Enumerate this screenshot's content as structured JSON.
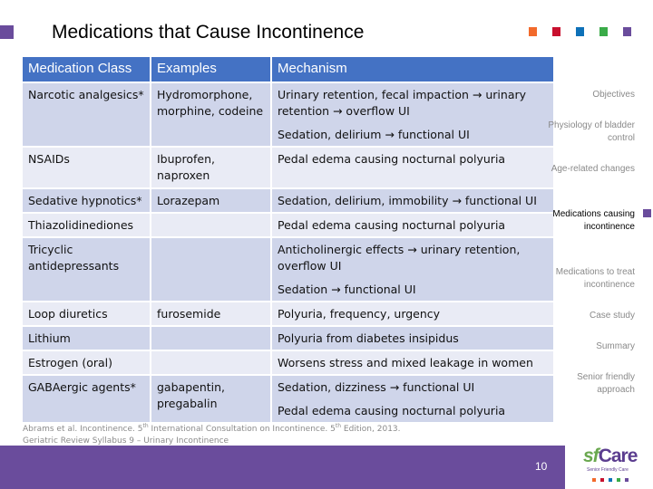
{
  "slide": {
    "title": "Medications that Cause Incontinence",
    "page_number": "10",
    "accent_color": "#6a4c9c",
    "top_squares": [
      "#f26a2b",
      "#c8102e",
      "#0e71b8",
      "#3aab48",
      "#6a4c9c"
    ]
  },
  "table": {
    "headers": [
      "Medication Class",
      "Examples",
      "Mechanism"
    ],
    "rows": [
      {
        "class": "Narcotic analgesics*",
        "examples": "Hydromorphone, morphine, codeine",
        "mechanism": [
          "Urinary retention, fecal impaction → urinary retention → overflow UI",
          "Sedation, delirium → functional UI"
        ]
      },
      {
        "class": "NSAIDs",
        "examples": "Ibuprofen, naproxen",
        "mechanism": [
          "Pedal edema causing nocturnal polyuria"
        ]
      },
      {
        "class": "Sedative hypnotics*",
        "examples": "Lorazepam",
        "mechanism": [
          "Sedation, delirium, immobility → functional UI"
        ]
      },
      {
        "class": "Thiazolidinediones",
        "examples": "",
        "mechanism": [
          "Pedal edema causing nocturnal polyuria"
        ]
      },
      {
        "class": "Tricyclic antidepressants",
        "examples": "",
        "mechanism": [
          "Anticholinergic effects → urinary retention, overflow UI",
          "Sedation →  functional UI"
        ]
      },
      {
        "class": "Loop diuretics",
        "examples": "furosemide",
        "mechanism": [
          "Polyuria, frequency, urgency"
        ]
      },
      {
        "class": "Lithium",
        "examples": "",
        "mechanism": [
          "Polyuria from diabetes insipidus"
        ]
      },
      {
        "class": "Estrogen (oral)",
        "examples": "",
        "mechanism": [
          "Worsens stress and mixed leakage in women"
        ]
      },
      {
        "class": "GABAergic agents*",
        "examples": "gabapentin, pregabalin",
        "mechanism": [
          "Sedation, dizziness → functional UI",
          "Pedal edema causing nocturnal polyuria"
        ]
      }
    ]
  },
  "sidebar": {
    "items": [
      {
        "label": "Objectives",
        "active": false
      },
      {
        "label": "Physiology of bladder control",
        "active": false
      },
      {
        "label": "Age-related changes",
        "active": false
      },
      {
        "label": "Medications causing incontinence",
        "active": true
      },
      {
        "label": "Medications to treat incontinence",
        "active": false
      },
      {
        "label": "Case study",
        "active": false
      },
      {
        "label": "Summary",
        "active": false
      },
      {
        "label": "Senior friendly approach",
        "active": false
      }
    ]
  },
  "references": {
    "line1_a": "Abrams et al. Incontinence. 5",
    "line1_sup1": "th",
    "line1_b": " International Consultation on Incontinence. 5",
    "line1_sup2": "th",
    "line1_c": " Edition, 2013.",
    "line2": "Geriatric Review Syllabus 9 – Urinary Incontinence"
  },
  "logo": {
    "sf": "sf",
    "care": "Care",
    "subtitle": "Senior Friendly Care",
    "squares": [
      "#f26a2b",
      "#c8102e",
      "#0e71b8",
      "#3aab48",
      "#6a4c9c"
    ]
  }
}
